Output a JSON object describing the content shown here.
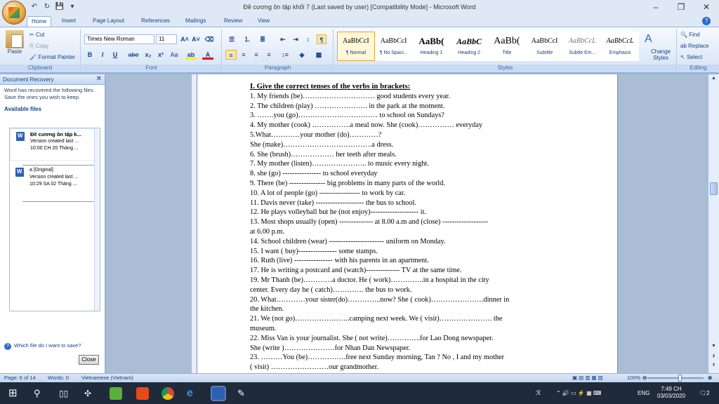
{
  "window": {
    "title": "Đề cương ôn tập khối 7 (Last saved by user) [Compatibility Mode] - Microsoft Word",
    "minimize": "–",
    "maximize": "❐",
    "close": "✕"
  },
  "qat": {
    "save": "💾",
    "undo": "↶",
    "redo": "↻",
    "more": "▾"
  },
  "tabs": [
    "Home",
    "Insert",
    "Page Layout",
    "References",
    "Mailings",
    "Review",
    "View"
  ],
  "help": "?",
  "clipboard": {
    "paste": "Paste",
    "cut": "Cut",
    "copy": "Copy",
    "format_painter": "Format Painter",
    "label": "Clipboard"
  },
  "font": {
    "family": "Times New Roman",
    "size": "11",
    "bold": "B",
    "italic": "I",
    "underline": "U",
    "strike": "abe",
    "sub": "x₂",
    "sup": "x²",
    "case": "Aa",
    "grow": "A˄",
    "shrink": "A˅",
    "label": "Font"
  },
  "paragraph": {
    "label": "Paragraph",
    "pilcrow": "¶"
  },
  "styles": {
    "label": "Styles",
    "items": [
      {
        "sample": "AaBbCcI",
        "name": "¶ Normal"
      },
      {
        "sample": "AaBbCcI",
        "name": "¶ No Spaci..."
      },
      {
        "sample": "AaBb(",
        "name": "Heading 1"
      },
      {
        "sample": "AaBbC",
        "name": "Heading 2"
      },
      {
        "sample": "AaBb(",
        "name": "Title"
      },
      {
        "sample": "AaBbCcI",
        "name": "Subtitle"
      },
      {
        "sample": "AaBbCcL",
        "name": "Subtle Em..."
      },
      {
        "sample": "AaBbCcL",
        "name": "Emphasis"
      }
    ],
    "change_styles": "Change Styles"
  },
  "editing": {
    "label": "Editing",
    "find": "Find",
    "replace": "Replace",
    "select": "Select"
  },
  "recovery": {
    "title": "Document Recovery",
    "message": "Word has recovered the following files.  Save the ones you wish to keep.",
    "available": "Available files",
    "files": [
      {
        "name": "Đề cương ôn tập k...",
        "line1": "Version created last ...",
        "line2": "10:00 CH 20 Tháng ..."
      },
      {
        "name": "a  [Original]",
        "line1": "Version created last ...",
        "line2": "10:29 SA 02 Tháng ..."
      }
    ],
    "which": "Which file do I want to save?",
    "close": "Close"
  },
  "document": {
    "heading": "I. Give the correct tenses of the verbs in brackets:",
    "lines": [
      "1. My friends (be)………………………… good students every year.",
      "2. The children (play) …………………. in the park at the moment.",
      "3. …….you (go)…………………………… to school on Sundays?",
      "4. My mother (cook) …………….a meal now. She (cook)…………… everyday",
      "5.What…………your mother (do)…………?",
      "She (make)……………………………….a dress.",
      "6. She (brush)……………… her teeth after meals.",
      "7. My mother (listen)………………….. to music every night.",
      "8. she (go) ---------------- to school everyday",
      "9. There (be)  --------------- big problems in many parts of the world.",
      "10. A lot of people (go) ----------------- to work by car.",
      "11. Davis never (take) -------------------- the bus to school.",
      "12. He plays volleyball but he (not enjoy)--------------------  it.",
      "13. Most shops usually (open) -------------- at 8.00 a.m and (close) -------------------",
      "at 6.00 p.m.",
      "14. School children (wear) ----------------------- uniform on Monday.",
      "15. I want ( buy)----------------  some stamps.",
      "16. Ruth (live) ---------------- with his parents in an apartment.",
      "17. He is writing a postcard and (watch)-------------- TV at the same time.",
      "19. Mr Thanh (be)…………a doctor. He ( work)…………..in a hospital in the city",
      "center. Every day he ( catch)…………. the bus to work.",
      "20. What…………your sister(do)…………..now? She ( cook)………………….dinner in",
      "the kitchen.",
      "21. We (not go)…………………..camping next week. We ( visit)…………………. the",
      "museum.",
      "22. Miss Van is your journalist. She ( not write)…………..for  Lao Dong newspaper.",
      "She (write )…………………for Nhan Dan Newspaper.",
      "23. ………You (be)…………….free next Sunday morning, Tan ? No , I and my mother",
      "( visit) ……………………our grandmother."
    ]
  },
  "status": {
    "page": "Page: 6 of 14",
    "words": "Words: 0",
    "language": "Vietnamese (Vietnam)",
    "zoom": "100%"
  },
  "taskbar": {
    "lang": "ENG",
    "time": "7:49 CH",
    "date": "03/03/2020",
    "notif": "2"
  }
}
